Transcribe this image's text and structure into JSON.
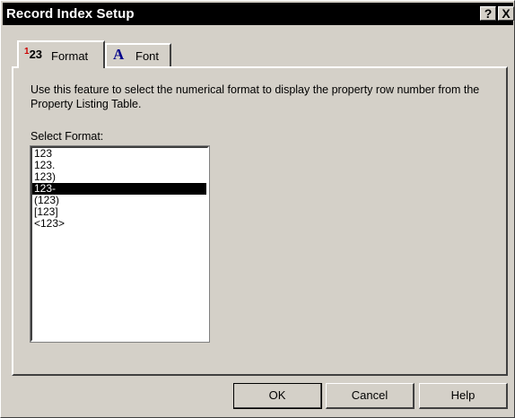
{
  "window": {
    "title": "Record Index Setup",
    "help_button": "?",
    "close_button": "X"
  },
  "tabs": [
    {
      "label": "Format",
      "icon": "numbers-123-icon",
      "active": true
    },
    {
      "label": "Font",
      "icon": "font-a-icon",
      "active": false
    }
  ],
  "tab_icons": {
    "format_glyph_superscript": "1",
    "format_glyph_rest": "23",
    "font_glyph": "A"
  },
  "content": {
    "description": "Use this feature to select the numerical format to display the property row number from the Property Listing Table.",
    "select_label": "Select Format:",
    "formats": [
      "123",
      "123.",
      "123)",
      "123-",
      "(123)",
      "[123]",
      "<123>"
    ],
    "selected_format": "123-"
  },
  "buttons": {
    "ok": "OK",
    "cancel": "Cancel",
    "help": "Help"
  },
  "colors": {
    "dialog_bg": "#d4d0c8",
    "titlebar_bg": "#000000",
    "selection_bg": "#000000",
    "selection_fg": "#ffffff",
    "format_icon_accent": "#cc0000",
    "font_icon_color": "#00008b"
  }
}
